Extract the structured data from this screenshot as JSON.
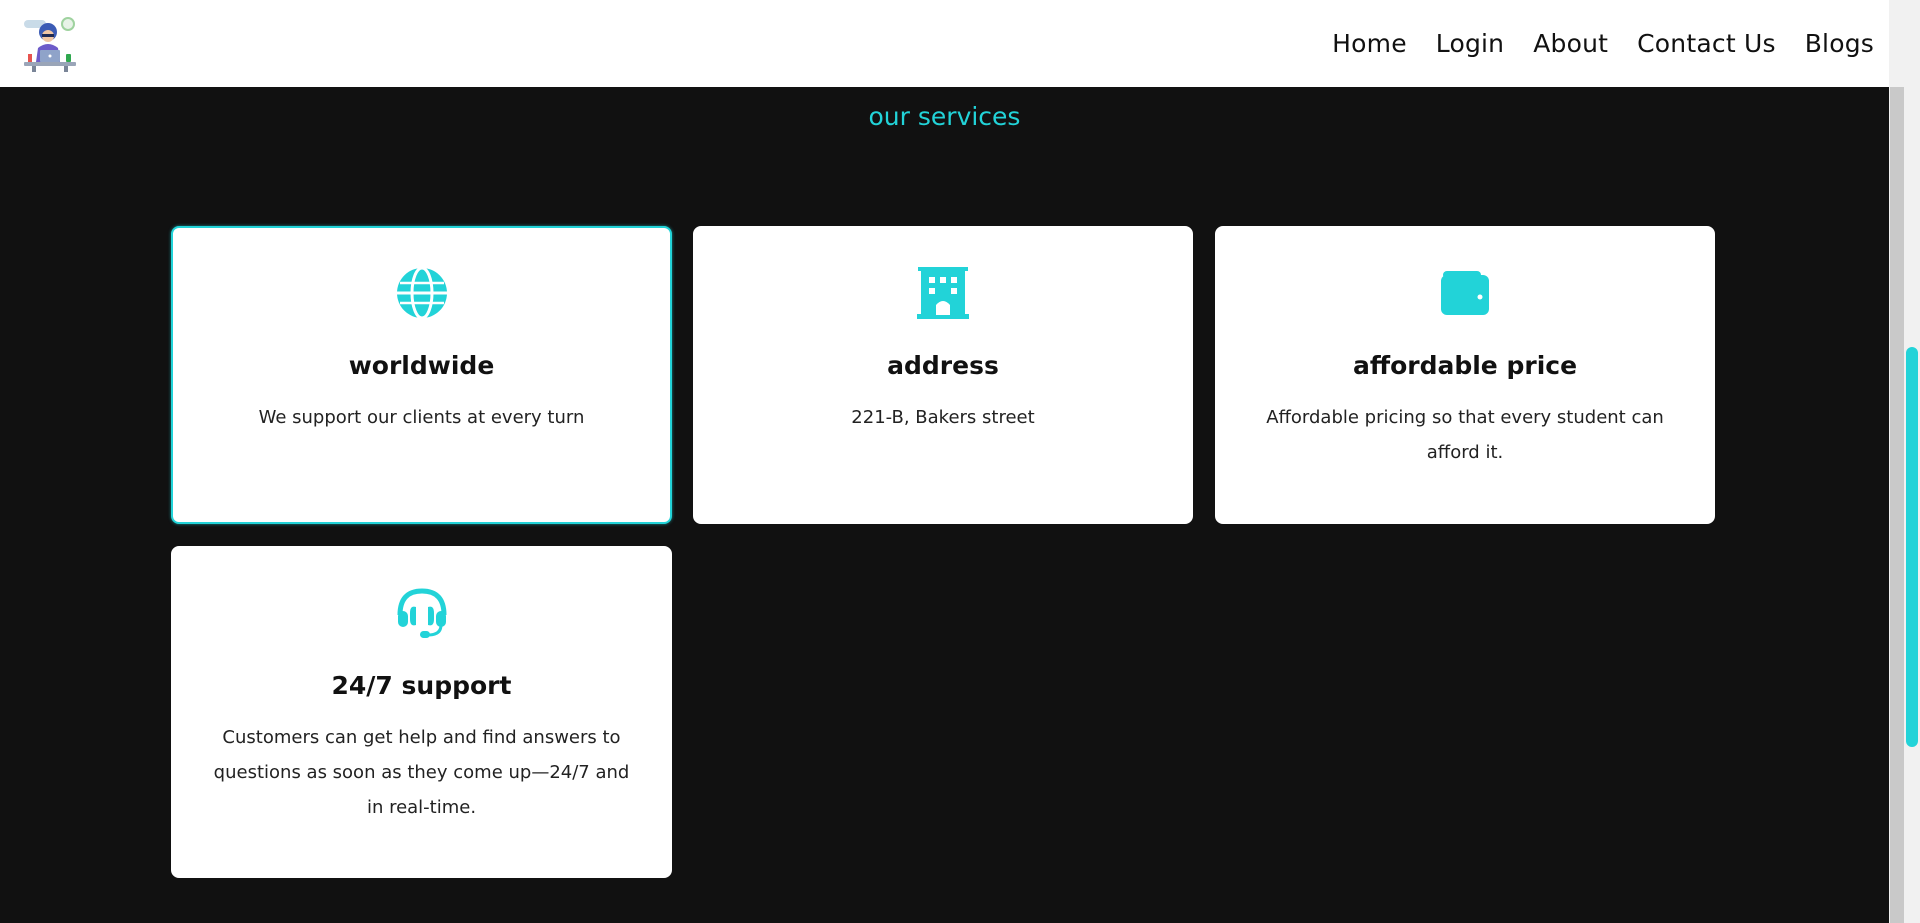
{
  "nav": {
    "items": [
      "Home",
      "Login",
      "About",
      "Contact Us",
      "Blogs"
    ]
  },
  "section": {
    "title": "our services"
  },
  "services": [
    {
      "icon": "globe-icon",
      "title": "worldwide",
      "description": "We support our clients at every turn"
    },
    {
      "icon": "building-icon",
      "title": "address",
      "description": "221-B, Bakers street"
    },
    {
      "icon": "wallet-icon",
      "title": "affordable price",
      "description": "Affordable pricing so that every student can afford it."
    },
    {
      "icon": "headset-icon",
      "title": "24/7 support",
      "description": "Customers can get help and find answers to questions as soon as they come up—24/7 and in real-time."
    }
  ],
  "colors": {
    "accent": "#22d3d8",
    "background": "#111111",
    "card": "#ffffff"
  }
}
